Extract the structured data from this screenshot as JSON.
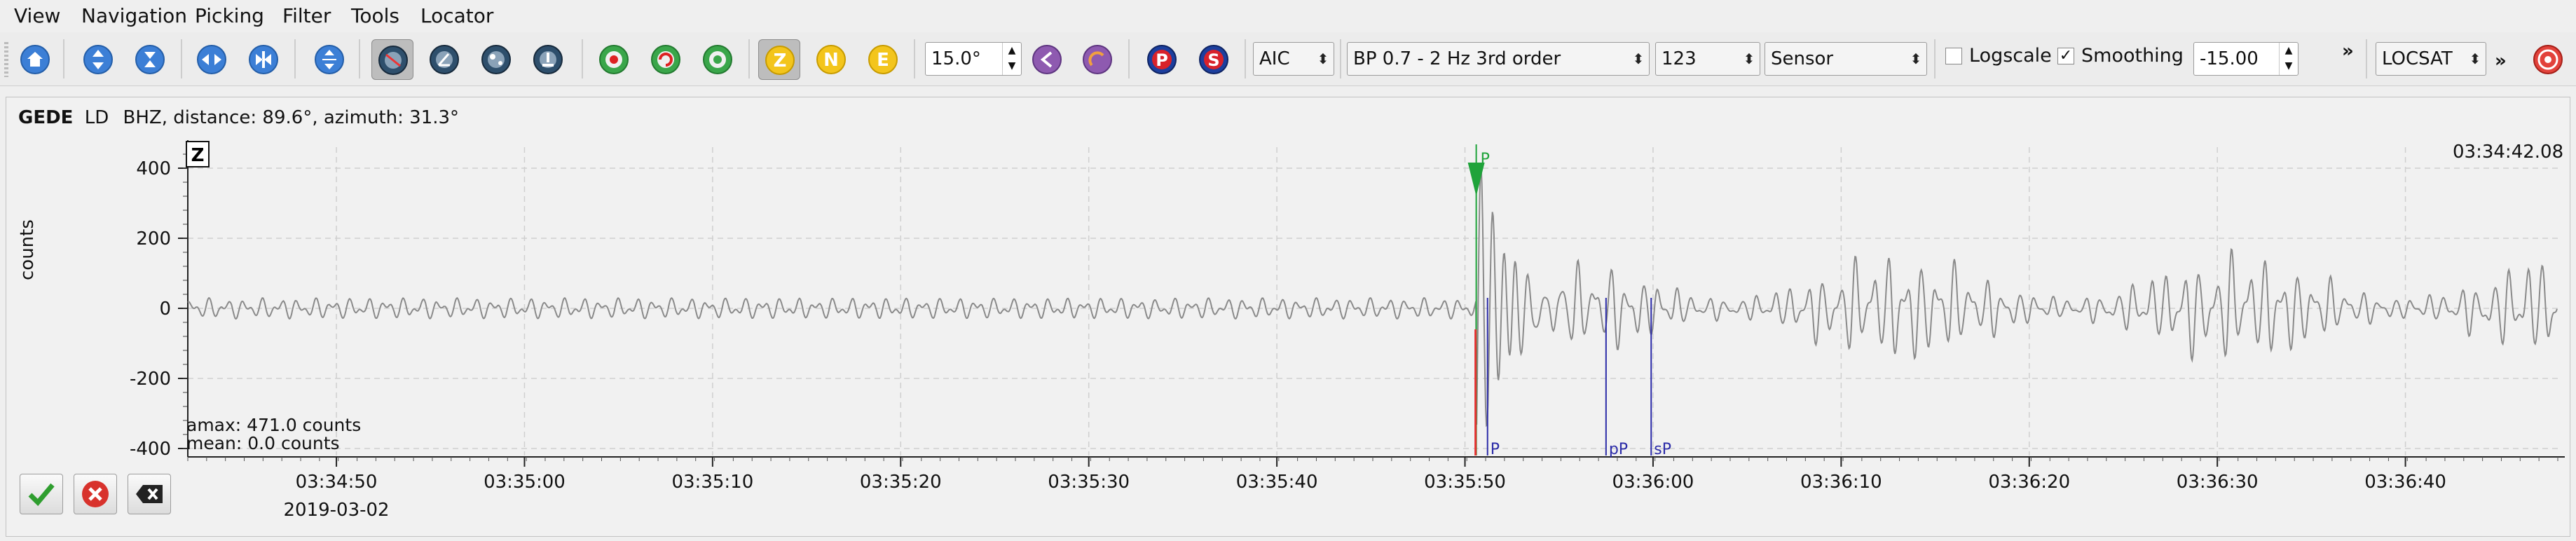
{
  "menu": [
    "View",
    "Navigation",
    "Picking",
    "Filter",
    "Tools",
    "Locator"
  ],
  "toolbar": {
    "zoom_value": "15.0°",
    "picker": "AIC",
    "filter": "BP 0.7 - 2 Hz  3rd order",
    "rotation": "123",
    "unit": "Sensor",
    "logscale_label": "Logscale",
    "logscale_checked": false,
    "smoothing_label": "Smoothing",
    "smoothing_checked": true,
    "offset_value": "-15.00",
    "locator": "LOCSAT",
    "comp_z": "Z",
    "comp_n": "N",
    "comp_e": "E",
    "phase_p": "P",
    "phase_s": "S",
    "overflow": "»"
  },
  "station": {
    "code": "GEDE",
    "network": "LD",
    "info": "BHZ, distance: 89.6°, azimuth: 31.3°"
  },
  "plot": {
    "component_label": "Z",
    "ylabel": "counts",
    "time_readout": "03:34:42.08",
    "amax": "amax: 471.0 counts",
    "mean": "mean: 0.0 counts",
    "date": "2019-03-02"
  },
  "chart_data": {
    "type": "line",
    "ylabel": "counts",
    "ylim": [
      -420,
      460
    ],
    "yticks": [
      400,
      200,
      0,
      -200,
      -400
    ],
    "xlim_seconds": [
      0,
      126
    ],
    "xtick_labels": [
      "03:34:50",
      "03:35:00",
      "03:35:10",
      "03:35:20",
      "03:35:30",
      "03:35:40",
      "03:35:50",
      "03:36:00",
      "03:36:10",
      "03:36:20",
      "03:36:30",
      "03:36:40"
    ],
    "xtick_seconds": [
      7.9,
      17.9,
      27.9,
      37.9,
      47.9,
      57.9,
      67.9,
      77.9,
      87.9,
      97.9,
      107.9,
      117.9
    ],
    "grid": true,
    "picks": [
      {
        "label": "P",
        "second": 68.5,
        "color": "#1fa33a",
        "kind": "manual"
      },
      {
        "label": "P",
        "second": 69.1,
        "color": "#2b2ba8",
        "kind": "theoretical"
      },
      {
        "label": "pP",
        "second": 75.4,
        "color": "#2b2ba8",
        "kind": "theoretical"
      },
      {
        "label": "sP",
        "second": 77.8,
        "color": "#2b2ba8",
        "kind": "theoretical"
      }
    ],
    "waveform": {
      "pre_noise_amplitude": 30,
      "onset_second": 68.5,
      "peak_amplitude": 471,
      "coda_amplitude": 180
    }
  },
  "icons": {
    "home": "home-icon",
    "up": "arrow-up-icon",
    "down": "arrow-down-icon",
    "left": "arrow-left-icon",
    "right": "arrow-right-icon",
    "accept": "check-icon",
    "reject": "cross-icon",
    "delete": "delete-icon"
  },
  "colors": {
    "accent_yellow": "#f3c51c",
    "pick_green": "#1fa33a",
    "theory_blue": "#2b2ba8",
    "onset_red": "#e53030"
  }
}
